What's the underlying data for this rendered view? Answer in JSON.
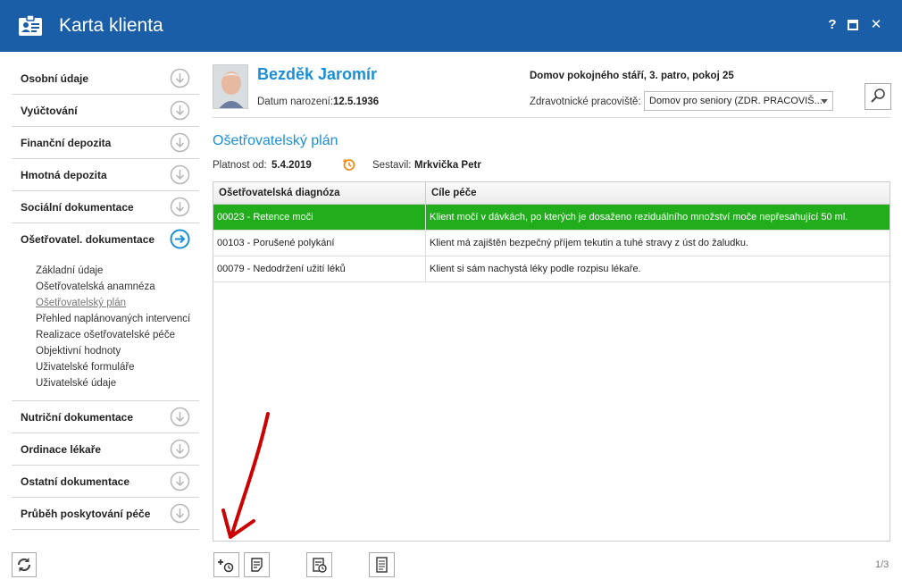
{
  "window": {
    "title": "Karta klienta",
    "help_label": "?",
    "close_label": "✕"
  },
  "sidebar": {
    "items_top": [
      {
        "label": "Osobní údaje"
      },
      {
        "label": "Vyúčtování"
      },
      {
        "label": "Finanční depozita"
      },
      {
        "label": "Hmotná depozita"
      },
      {
        "label": "Sociální dokumentace"
      },
      {
        "label": "Ošetřovatel. dokumentace"
      }
    ],
    "subitems": [
      {
        "label": "Základní údaje"
      },
      {
        "label": "Ošetřovatelská anamnéza"
      },
      {
        "label": "Ošetřovatelský plán"
      },
      {
        "label": "Přehled naplánovaných intervencí"
      },
      {
        "label": "Realizace ošetřovatelské péče"
      },
      {
        "label": "Objektivní hodnoty"
      },
      {
        "label": "Uživatelské formuláře"
      },
      {
        "label": "Uživatelské údaje"
      }
    ],
    "items_bottom": [
      {
        "label": "Nutriční dokumentace"
      },
      {
        "label": "Ordinace lékaře"
      },
      {
        "label": "Ostatní dokumentace"
      },
      {
        "label": "Průběh poskytování péče"
      }
    ]
  },
  "client": {
    "name": "Bezděk Jaromír",
    "dob_label": "Datum narození:",
    "dob_value": "12.5.1936",
    "facility": "Domov pokojného stáří, 3. patro, pokoj 25",
    "workplace_label": "Zdravotnické pracoviště:",
    "workplace_value": "Domov pro seniory (ZDR. PRACOVIŠ..."
  },
  "plan": {
    "title": "Ošetřovatelský plán",
    "valid_label": "Platnost od:",
    "valid_value": "5.4.2019",
    "author_label": "Sestavil:",
    "author_value": "Mrkvička Petr"
  },
  "table": {
    "headers": [
      "Ošetřovatelská diagnóza",
      "Cíle péče"
    ],
    "rows": [
      {
        "diagnosis": "00023 - Retence moči",
        "goal": "Klient močí v dávkách, po kterých je dosaženo reziduálního množství moče nepřesahující 50 ml."
      },
      {
        "diagnosis": "00103 - Porušené polykání",
        "goal": "Klient má zajištěn bezpečný příjem tekutin a tuhé stravy z úst do žaludku."
      },
      {
        "diagnosis": "00079 - Nedodržení užití léků",
        "goal": "Klient si sám nachystá léky podle rozpisu lékaře."
      }
    ]
  },
  "pager": "1/3",
  "colors": {
    "titlebar": "#1a5ea8",
    "accent": "#1b8fd6",
    "selected_row": "#22ad1c",
    "arrow": "#cc0000"
  }
}
